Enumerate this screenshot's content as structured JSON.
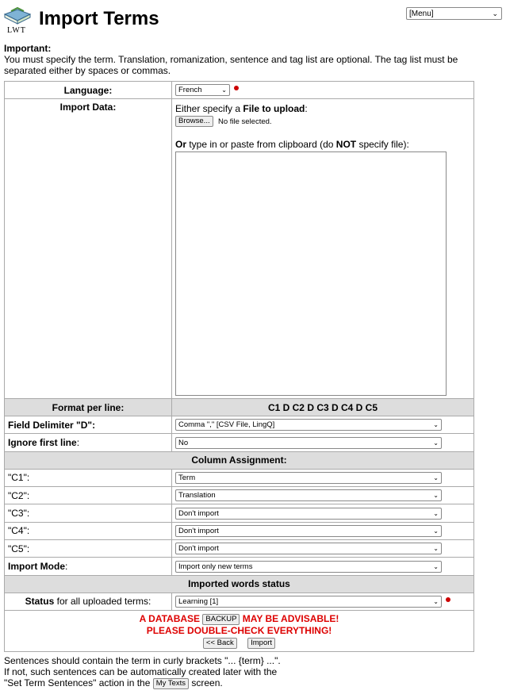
{
  "header": {
    "title": "Import Terms",
    "logo_text": "LWT",
    "menu": "[Menu]"
  },
  "important": {
    "label": "Important:",
    "text": "You must specify the term. Translation, romanization, sentence and tag list are optional. The tag list must be separated either by spaces or commas."
  },
  "form": {
    "language_label": "Language:",
    "language_value": "French",
    "import_label": "Import Data:",
    "file_pre": "Either specify a ",
    "file_bold": "File to upload",
    "file_post": ":",
    "browse": "Browse...",
    "no_file": "No file selected.",
    "or_bold": "Or",
    "or_mid": " type in or paste from clipboard (do ",
    "not_bold": "NOT",
    "or_post": " specify file):",
    "format_label": "Format per line:",
    "format_value": "C1 D C2 D C3 D C4 D C5",
    "delim_label": "Field Delimiter \"D\":",
    "delim_value": "Comma \",\" [CSV File, LingQ]",
    "ignore_label": "Ignore first line",
    "ignore_colon": ":",
    "ignore_value": "No",
    "col_assign": "Column Assignment:",
    "columns": [
      {
        "label": "\"C1\":",
        "value": "Term"
      },
      {
        "label": "\"C2\":",
        "value": "Translation"
      },
      {
        "label": "\"C3\":",
        "value": "Don't import"
      },
      {
        "label": "\"C4\":",
        "value": "Don't import"
      },
      {
        "label": "\"C5\":",
        "value": "Don't import"
      }
    ],
    "mode_label": "Import Mode",
    "mode_colon": ":",
    "mode_value": "Import only new terms",
    "imported_status": "Imported words status",
    "status_bold": "Status",
    "status_rest": " for all uploaded terms:",
    "status_value": "Learning [1]",
    "warn1_pre": "A DATABASE ",
    "backup": "BACKUP",
    "warn1_post": " MAY BE ADVISABLE!",
    "warn2": "PLEASE DOUBLE-CHECK EVERYTHING!",
    "back": "<< Back",
    "import": "Import"
  },
  "footer": {
    "line1": "Sentences should contain the term in curly brackets \"... {term} ...\".",
    "line2": "If not, such sentences can be automatically created later with the",
    "line3_pre": "\"Set Term Sentences\" action in the ",
    "my_texts": "My Texts",
    "line3_post": " screen."
  }
}
